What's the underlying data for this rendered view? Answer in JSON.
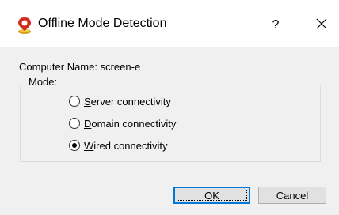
{
  "window": {
    "title": "Offline Mode Detection",
    "help_label": "?",
    "close_label": "✕",
    "icon": "offline-detection-icon"
  },
  "computer": {
    "label": "Computer Name: screen-e"
  },
  "mode": {
    "legend": "Mode:",
    "options": [
      {
        "mnemonic": "S",
        "rest": "erver connectivity",
        "selected": false
      },
      {
        "mnemonic": "D",
        "rest": "omain connectivity",
        "selected": false
      },
      {
        "mnemonic": "W",
        "rest": "ired connectivity",
        "selected": true
      }
    ]
  },
  "buttons": {
    "ok_label": "OK",
    "cancel_label": "Cancel"
  },
  "colors": {
    "accent": "#0078d7",
    "titlebar": "#ffffff",
    "background": "#f0f0f0"
  }
}
